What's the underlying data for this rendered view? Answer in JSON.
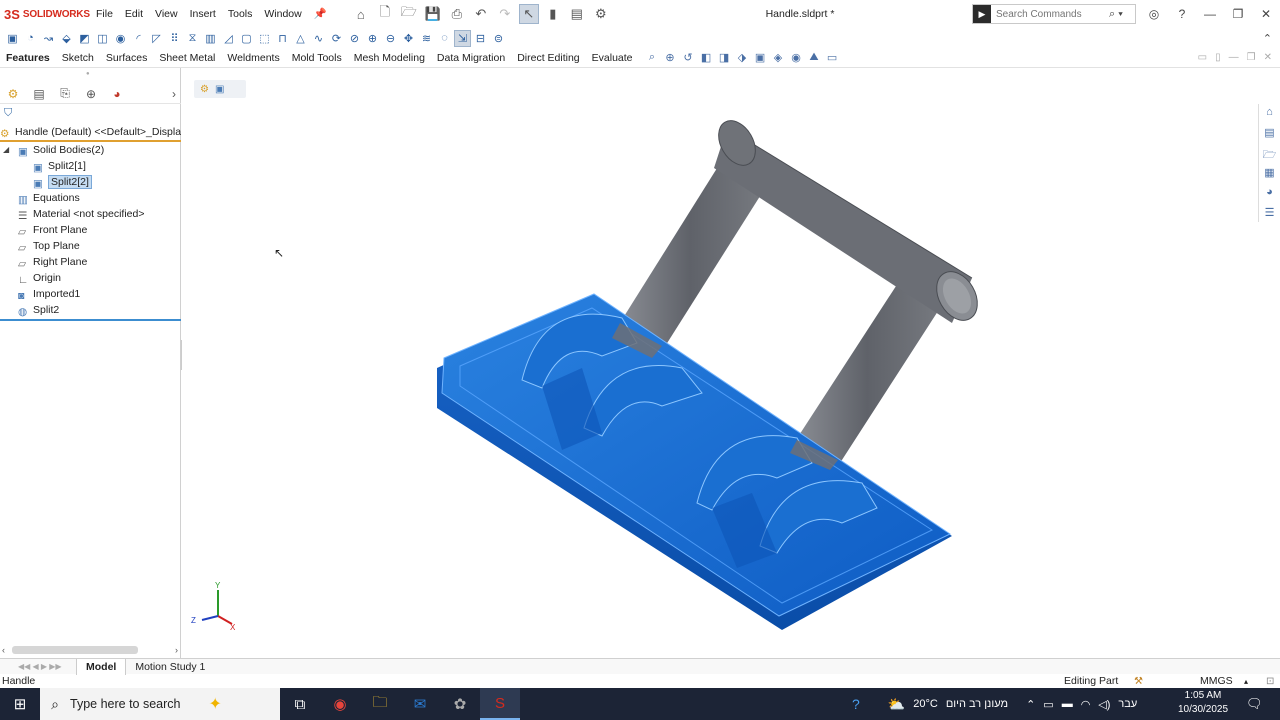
{
  "app": {
    "logo_mark": "3S",
    "logo_text": "SOLIDWORKS",
    "doc_title": "Handle.sldprt *",
    "menu": [
      "File",
      "Edit",
      "View",
      "Insert",
      "Tools",
      "Window"
    ],
    "search_placeholder": "Search Commands"
  },
  "tabs": [
    "Features",
    "Sketch",
    "Surfaces",
    "Sheet Metal",
    "Weldments",
    "Mold Tools",
    "Mesh Modeling",
    "Data Migration",
    "Direct Editing",
    "Evaluate"
  ],
  "tree": {
    "root": "Handle (Default) <<Default>_Display",
    "solid_bodies": "Solid Bodies(2)",
    "body1": "Split2[1]",
    "body2": "Split2[2]",
    "equations": "Equations",
    "material": "Material <not specified>",
    "front_plane": "Front Plane",
    "top_plane": "Top Plane",
    "right_plane": "Right Plane",
    "origin": "Origin",
    "imported": "Imported1",
    "split": "Split2"
  },
  "bottom_tabs": {
    "model": "Model",
    "motion": "Motion Study 1"
  },
  "status": {
    "left": "Handle",
    "mode": "Editing Part",
    "units": "MMGS"
  },
  "taskbar": {
    "search_placeholder": "Type here to search",
    "weather": "20°C",
    "weather_text": "מעונן רב היום",
    "lang": "עבר",
    "time": "1:05 AM",
    "date": "10/30/2025"
  },
  "colors": {
    "brand": "#d52b1e",
    "selection_blue": "#1a6fd1",
    "handle_gray": "#6e7178"
  }
}
